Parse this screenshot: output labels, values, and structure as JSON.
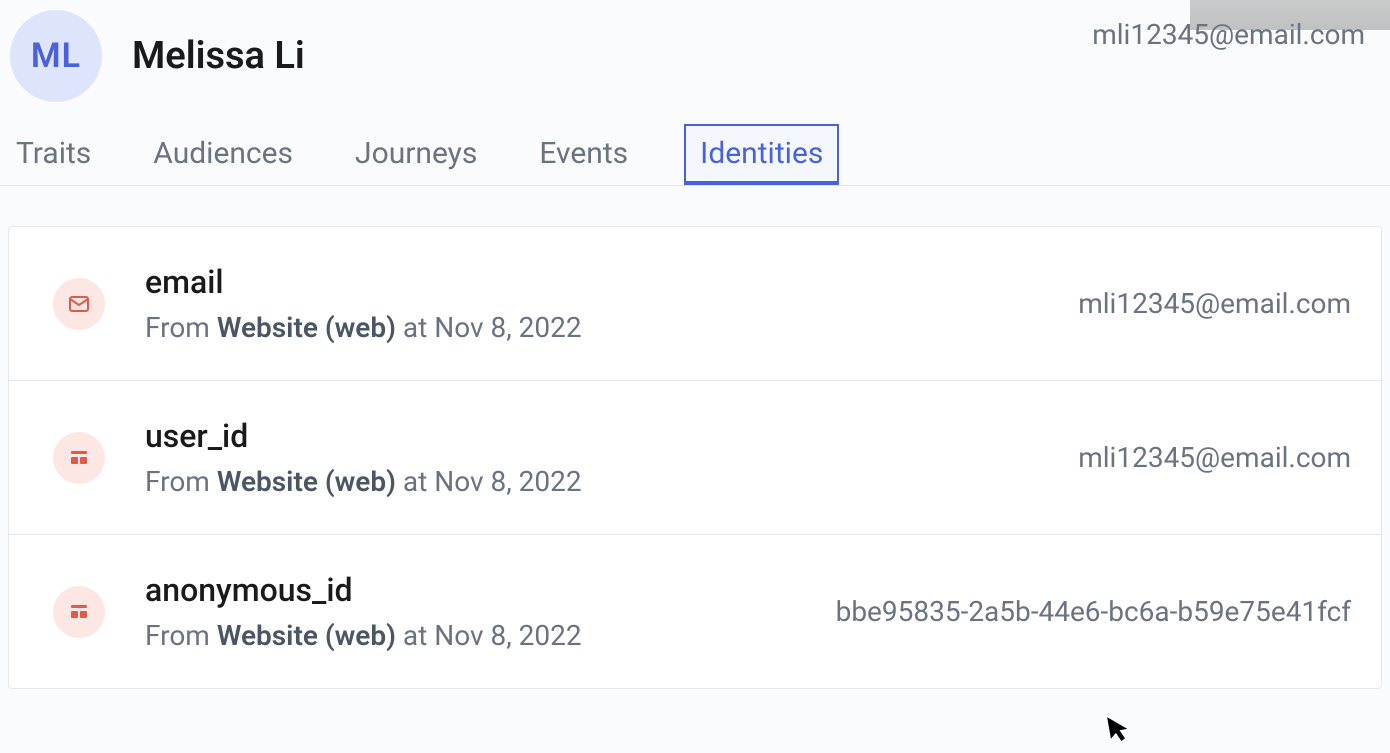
{
  "header": {
    "avatar_initials": "ML",
    "name": "Melissa Li",
    "email": "mli12345@email.com"
  },
  "tabs": {
    "items": [
      {
        "label": "Traits",
        "active": false
      },
      {
        "label": "Audiences",
        "active": false
      },
      {
        "label": "Journeys",
        "active": false
      },
      {
        "label": "Events",
        "active": false
      },
      {
        "label": "Identities",
        "active": true
      }
    ]
  },
  "identities": {
    "items": [
      {
        "icon": "email-icon",
        "title": "email",
        "source_prefix": "From ",
        "source_bold": "Website (web)",
        "source_suffix": " at Nov 8, 2022",
        "value": "mli12345@email.com"
      },
      {
        "icon": "id-icon",
        "title": "user_id",
        "source_prefix": "From ",
        "source_bold": "Website (web)",
        "source_suffix": " at Nov 8, 2022",
        "value": "mli12345@email.com"
      },
      {
        "icon": "id-icon",
        "title": "anonymous_id",
        "source_prefix": "From ",
        "source_bold": "Website (web)",
        "source_suffix": " at Nov 8, 2022",
        "value": "bbe95835-2a5b-44e6-bc6a-b59e75e41fcf"
      }
    ]
  }
}
